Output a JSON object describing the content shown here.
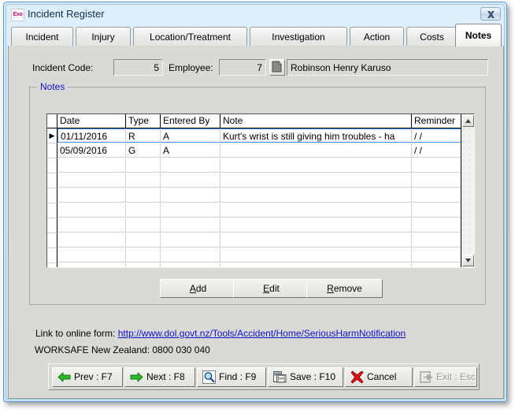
{
  "window": {
    "title": "Incident Register",
    "icon": "exo-logo-icon",
    "close_label": "close-icon"
  },
  "tabs": [
    {
      "label": "Incident",
      "active": false
    },
    {
      "label": "Injury",
      "active": false
    },
    {
      "label": "Location/Treatment",
      "active": false
    },
    {
      "label": "Investigation",
      "active": false
    },
    {
      "label": "Action",
      "active": false
    },
    {
      "label": "Costs",
      "active": false
    },
    {
      "label": "Notes",
      "active": true
    }
  ],
  "header": {
    "incident_code_label": "Incident Code:",
    "incident_code_value": "5",
    "employee_label": "Employee:",
    "employee_code_value": "7",
    "employee_name_value": "Robinson Henry Karuso",
    "lookup_icon": "page-lookup-icon"
  },
  "notes_group": {
    "title": "Notes",
    "columns": [
      "Date",
      "Type",
      "Entered By",
      "Note",
      "Reminder"
    ],
    "rows": [
      {
        "indicator": "▶",
        "selected": true,
        "Date": "01/11/2016",
        "Type": "R",
        "Entered By": "A",
        "Note": "Kurt's wrist is still giving him troubles - ha",
        "Reminder": "/ /"
      },
      {
        "indicator": "",
        "selected": false,
        "Date": "05/09/2016",
        "Type": "G",
        "Entered By": "A",
        "Note": "",
        "Reminder": "/ /"
      }
    ],
    "empty_row_count": 8,
    "scroll_up_icon": "scroll-up-arrow-icon",
    "scroll_down_icon": "scroll-down-arrow-icon"
  },
  "record_buttons": {
    "add": {
      "prefix": "",
      "accel": "A",
      "suffix": "dd"
    },
    "edit": {
      "prefix": "",
      "accel": "E",
      "suffix": "dit"
    },
    "remove": {
      "prefix": "",
      "accel": "R",
      "suffix": "emove"
    }
  },
  "links": {
    "link_label": "Link to online form:",
    "link_text": "http://www.dol.govt.nz/Tools/Accident/Home/SeriousHarmNotification",
    "worksafe_text": "WORKSAFE New Zealand: 0800 030 040"
  },
  "toolbar": [
    {
      "label": "Prev : F7",
      "icon": "arrow-left-green-icon",
      "disabled": false
    },
    {
      "label": "Next : F8",
      "icon": "arrow-right-green-icon",
      "disabled": false
    },
    {
      "label": "Find : F9",
      "icon": "magnifier-icon",
      "disabled": false
    },
    {
      "label": "Save : F10",
      "icon": "save-disk-icon",
      "disabled": false
    },
    {
      "label": "Cancel",
      "icon": "red-cross-icon",
      "disabled": false
    },
    {
      "label": "Exit : Esc",
      "icon": "exit-door-arrow-icon",
      "disabled": true
    }
  ],
  "colors": {
    "window_frame": "#5b9bd5",
    "face": "#d9d9d6",
    "link": "#1111cc",
    "group_label": "#1111cc",
    "selection_border": "#4a90d9",
    "arrow_green": "#1f9c1f",
    "cancel_red": "#cc1414"
  }
}
